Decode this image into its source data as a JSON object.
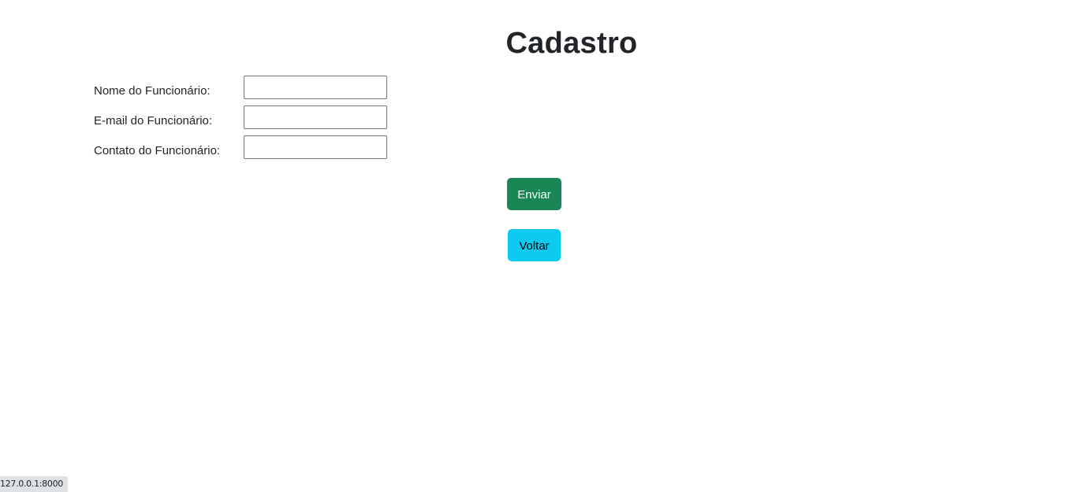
{
  "page": {
    "title": "Cadastro"
  },
  "form": {
    "fields": [
      {
        "label": "Nome do Funcionário:",
        "value": "",
        "placeholder": ""
      },
      {
        "label": "E-mail do Funcionário:",
        "value": "",
        "placeholder": ""
      },
      {
        "label": "Contato do Funcionário:",
        "value": "",
        "placeholder": ""
      }
    ]
  },
  "buttons": {
    "send_label": "Enviar",
    "send_color": "#198754",
    "back_label": "Voltar",
    "back_color": "#0dcaf0"
  },
  "status_bar": {
    "url": "127.0.0.1:8000"
  }
}
